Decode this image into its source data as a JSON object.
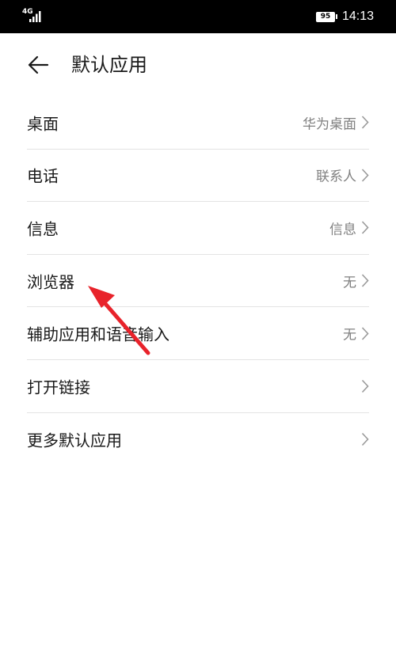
{
  "status_bar": {
    "network_type": "4G",
    "battery_level": "95",
    "time": "14:13"
  },
  "header": {
    "title": "默认应用"
  },
  "items": [
    {
      "label": "桌面",
      "value": "华为桌面"
    },
    {
      "label": "电话",
      "value": "联系人"
    },
    {
      "label": "信息",
      "value": "信息"
    },
    {
      "label": "浏览器",
      "value": "无"
    },
    {
      "label": "辅助应用和语音输入",
      "value": "无"
    },
    {
      "label": "打开链接",
      "value": ""
    },
    {
      "label": "更多默认应用",
      "value": ""
    }
  ],
  "colors": {
    "annotation_arrow": "#e8232b",
    "divider": "#e3e3e3",
    "secondary_text": "#808080"
  }
}
